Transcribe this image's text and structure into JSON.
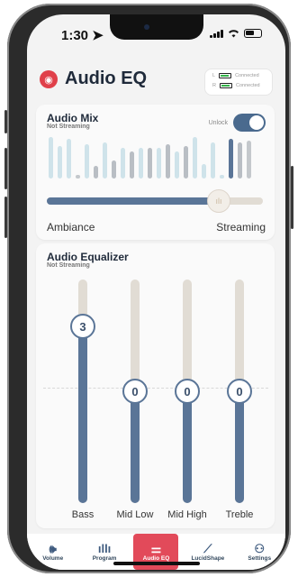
{
  "status": {
    "time": "1:30"
  },
  "header": {
    "title": "Audio EQ",
    "connections": [
      {
        "side": "L",
        "status": "Connected"
      },
      {
        "side": "R",
        "status": "Connected"
      }
    ]
  },
  "audio_mix": {
    "title": "Audio Mix",
    "subtitle": "Not Streaming",
    "unlock_label": "Unlock",
    "unlock_on": true,
    "left_label": "Ambiance",
    "right_label": "Streaming",
    "mix_level": 0.78
  },
  "audio_eq": {
    "title": "Audio Equalizer",
    "subtitle": "Not Streaming",
    "bands": [
      {
        "label": "Bass",
        "value": "3"
      },
      {
        "label": "Mid Low",
        "value": "0"
      },
      {
        "label": "Mid High",
        "value": "0"
      },
      {
        "label": "Treble",
        "value": "0"
      }
    ]
  },
  "tabs": [
    {
      "label": "Volume",
      "icon": "speaker-icon"
    },
    {
      "label": "Program",
      "icon": "program-bars-icon"
    },
    {
      "label": "Audio EQ",
      "icon": "eq-sliders-icon",
      "active": true
    },
    {
      "label": "LucidShape",
      "icon": "chart-line-icon"
    },
    {
      "label": "Settings",
      "icon": "user-icon"
    }
  ],
  "colors": {
    "accent": "#e24a5a",
    "slider": "#5a7597",
    "track": "#e1dcd4"
  }
}
